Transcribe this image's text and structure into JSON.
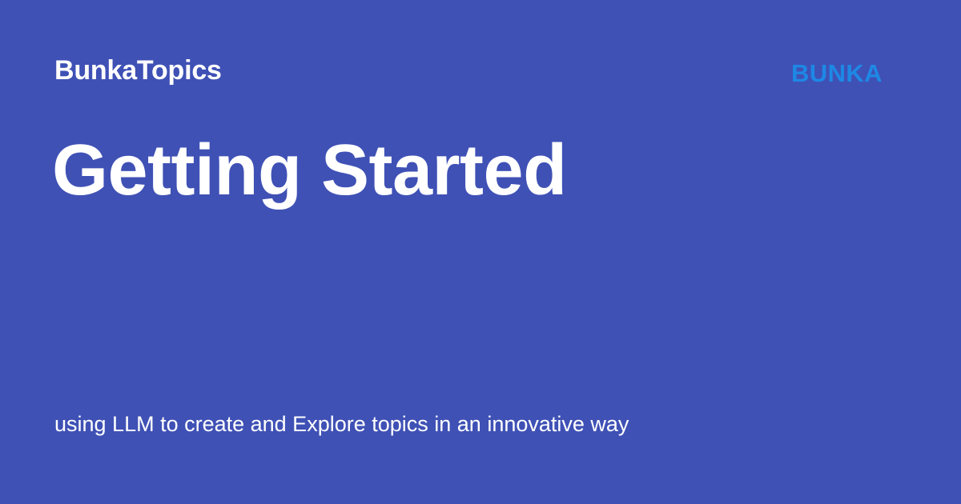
{
  "header": {
    "site_name": "BunkaTopics",
    "logo_text": "BUNKA"
  },
  "main": {
    "title": "Getting Started",
    "description": "using LLM to create and Explore topics in an innovative way"
  },
  "colors": {
    "background": "#3f51b5",
    "text": "#ffffff",
    "logo": "#1e88e5"
  }
}
